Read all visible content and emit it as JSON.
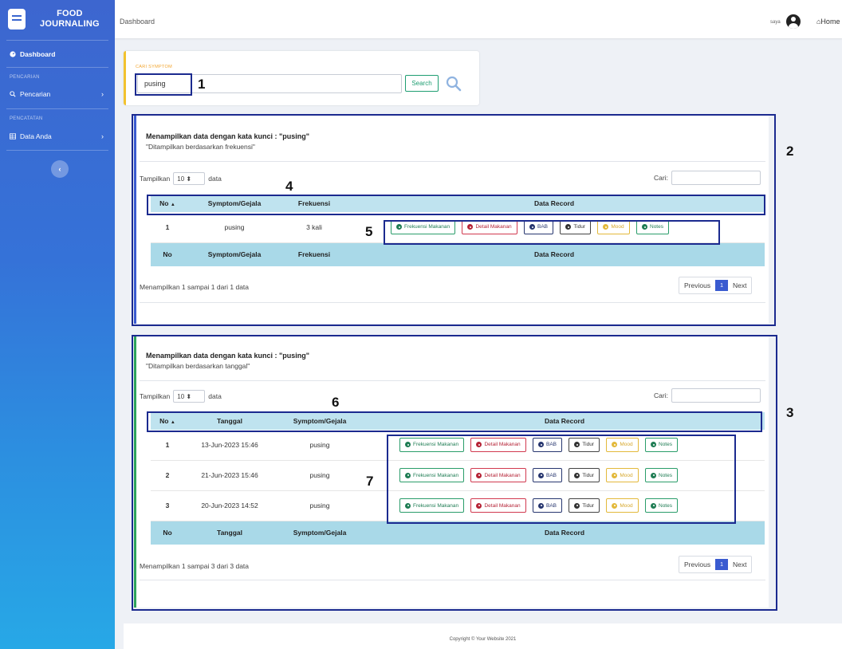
{
  "app": {
    "brand_line1": "FOOD",
    "brand_line2": "JOURNALING"
  },
  "sidebar": {
    "dashboard": "Dashboard",
    "heading_pencarian": "PENCARIAN",
    "pencarian": "Pencarian",
    "heading_pencatatan": "PENCATATAN",
    "data_anda": "Data Anda",
    "toggle": "‹"
  },
  "topbar": {
    "breadcrumb": "Dashboard",
    "user": "saya",
    "home": "⌂Home"
  },
  "search": {
    "label": "CARI SYMPTOM",
    "value": "pusing",
    "button": "Search"
  },
  "annotations": [
    "1",
    "2",
    "3",
    "4",
    "5",
    "6",
    "7"
  ],
  "freq_table": {
    "title": "Menampilkan data dengan kata kunci : \"pusing\"",
    "subtitle": "\"Ditampilkan berdasarkan frekuensi\"",
    "show_prefix": "Tampilkan",
    "show_value": "10",
    "show_suffix": "data",
    "search_label": "Cari:",
    "headers": [
      "No",
      "Symptom/Gejala",
      "Frekuensi",
      "Data Record"
    ],
    "rows": [
      {
        "no": "1",
        "symptom": "pusing",
        "freq": "3 kali"
      }
    ],
    "footer": [
      "No",
      "Symptom/Gejala",
      "Frekuensi",
      "Data Record"
    ],
    "info": "Menampilkan 1 sampai 1 dari 1 data",
    "prev": "Previous",
    "page": "1",
    "next": "Next"
  },
  "date_table": {
    "title": "Menampilkan data dengan kata kunci : \"pusing\"",
    "subtitle": "\"Ditampilkan berdasarkan tanggal\"",
    "show_prefix": "Tampilkan",
    "show_value": "10",
    "show_suffix": "data",
    "search_label": "Cari:",
    "headers": [
      "No",
      "Tanggal",
      "Symptom/Gejala",
      "Data Record"
    ],
    "rows": [
      {
        "no": "1",
        "date": "13-Jun-2023 15:46",
        "symptom": "pusing"
      },
      {
        "no": "2",
        "date": "21-Jun-2023 15:46",
        "symptom": "pusing"
      },
      {
        "no": "3",
        "date": "20-Jun-2023 14:52",
        "symptom": "pusing"
      }
    ],
    "footer": [
      "No",
      "Tanggal",
      "Symptom/Gejala",
      "Data Record"
    ],
    "info": "Menampilkan 1 sampai 3 dari 3 data",
    "prev": "Previous",
    "page": "1",
    "next": "Next"
  },
  "actions": [
    "Frekuensi Makanan",
    "Detail Makanan",
    "BAB",
    "Tidur",
    "Mood",
    "Notes"
  ],
  "footer": {
    "text": "Copyright © Your Website 2021"
  }
}
